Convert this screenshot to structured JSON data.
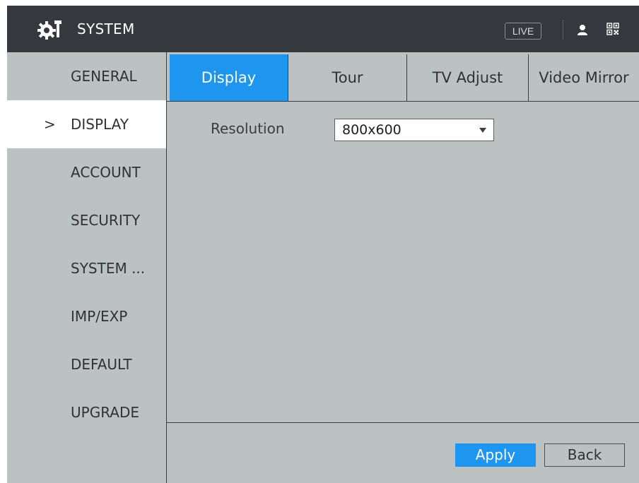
{
  "header": {
    "title": "SYSTEM",
    "logo_icon": "system-gear-wrench-icon",
    "live_label": "LIVE",
    "user_icon": "user-icon",
    "qr_icon": "qr-code-icon"
  },
  "sidebar": {
    "items": [
      {
        "label": "GENERAL",
        "active": false
      },
      {
        "label": "DISPLAY",
        "active": true
      },
      {
        "label": "ACCOUNT",
        "active": false
      },
      {
        "label": "SECURITY",
        "active": false
      },
      {
        "label": "SYSTEM ...",
        "active": false
      },
      {
        "label": "IMP/EXP",
        "active": false
      },
      {
        "label": "DEFAULT",
        "active": false
      },
      {
        "label": "UPGRADE",
        "active": false
      }
    ],
    "active_indicator": ">"
  },
  "tabs": [
    {
      "label": "Display",
      "active": true
    },
    {
      "label": "Tour",
      "active": false
    },
    {
      "label": "TV Adjust",
      "active": false
    },
    {
      "label": "Video Mirror",
      "active": false
    }
  ],
  "display": {
    "resolution_label": "Resolution",
    "resolution_value": "800x600"
  },
  "footer": {
    "apply_label": "Apply",
    "back_label": "Back"
  },
  "colors": {
    "accent": "#1e96f0",
    "titlebar": "#35393e",
    "panel_bg": "#bcc2c2"
  }
}
